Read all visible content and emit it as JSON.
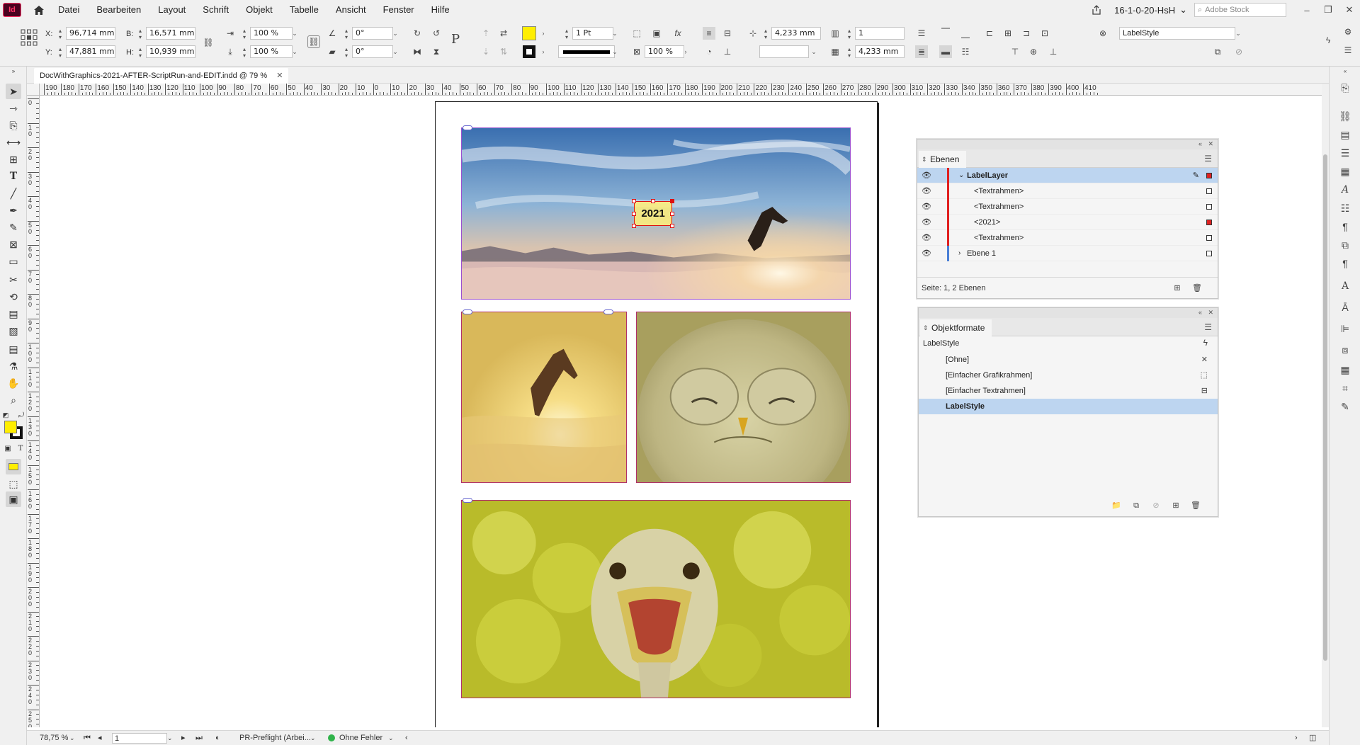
{
  "menubar": {
    "app_logo": "Id",
    "items": [
      "Datei",
      "Bearbeiten",
      "Layout",
      "Schrift",
      "Objekt",
      "Tabelle",
      "Ansicht",
      "Fenster",
      "Hilfe"
    ],
    "workspace": "16-1-0-20-HsH",
    "search_placeholder": "Adobe Stock"
  },
  "control": {
    "x_label": "X:",
    "x_value": "96,714 mm",
    "y_label": "Y:",
    "y_value": "47,881 mm",
    "w_label": "B:",
    "w_value": "16,571 mm",
    "h_label": "H:",
    "h_value": "10,939 mm",
    "scale_x": "100 %",
    "scale_y": "100 %",
    "rotate": "0°",
    "shear": "0°",
    "stroke_weight": "1 Pt",
    "opacity": "100 %",
    "inset_top": "4,233 mm",
    "inset_bottom": "4,233 mm",
    "columns": "1",
    "object_style": "LabelStyle",
    "fill_color": "#ffee00"
  },
  "document": {
    "tab_title": "DocWithGraphics-2021-AFTER-ScriptRun-and-EDIT.indd @ 79 %",
    "ruler_labels": [
      "190",
      "180",
      "170",
      "160",
      "150",
      "140",
      "130",
      "120",
      "110",
      "100",
      "90",
      "80",
      "70",
      "60",
      "50",
      "40",
      "30",
      "20",
      "10",
      "0",
      "10",
      "20",
      "30",
      "40",
      "50",
      "60",
      "70",
      "80",
      "90",
      "100",
      "110",
      "120",
      "130",
      "140",
      "150",
      "160",
      "170",
      "180",
      "190",
      "200",
      "210",
      "220",
      "230",
      "240",
      "250",
      "260",
      "270",
      "280",
      "290",
      "300",
      "310",
      "320",
      "330",
      "340",
      "350",
      "360",
      "370",
      "380",
      "390",
      "400",
      "410"
    ],
    "ruler_v_labels": [
      "0",
      "1 0",
      "2 0",
      "3 0",
      "4 0",
      "5 0",
      "6 0",
      "7 0",
      "8 0",
      "9 0",
      "1 0 0",
      "1 1 0",
      "1 2 0",
      "1 3 0",
      "1 4 0",
      "1 5 0",
      "1 6 0",
      "1 7 0",
      "1 8 0",
      "1 9 0",
      "2 0 0",
      "2 1 0",
      "2 2 0",
      "2 3 0",
      "2 4 0",
      "2 5 0"
    ],
    "label_text": "2021"
  },
  "layers_panel": {
    "title": "Ebenen",
    "rows": [
      {
        "label": "LabelLayer",
        "color": "#e02020",
        "selected": true
      },
      {
        "label": "<Textrahmen>",
        "color": "#e02020",
        "selected": false
      },
      {
        "label": "<Textrahmen>",
        "color": "#e02020",
        "selected": false
      },
      {
        "label": "<2021>",
        "color": "#e02020",
        "selected": false
      },
      {
        "label": "<Textrahmen>",
        "color": "#e02020",
        "selected": false
      },
      {
        "label": "Ebene 1",
        "color": "#4a7fd6",
        "selected": false
      }
    ],
    "footer": "Seite: 1, 2 Ebenen"
  },
  "styles_panel": {
    "title": "Objektformate",
    "current": "LabelStyle",
    "rows": [
      "[Ohne]",
      "[Einfacher Grafikrahmen]",
      "[Einfacher Textrahmen]",
      "LabelStyle"
    ]
  },
  "statusbar": {
    "zoom": "78,75 %",
    "page": "1",
    "preflight": "PR-Preflight (Arbei...",
    "errors": "Ohne Fehler"
  }
}
